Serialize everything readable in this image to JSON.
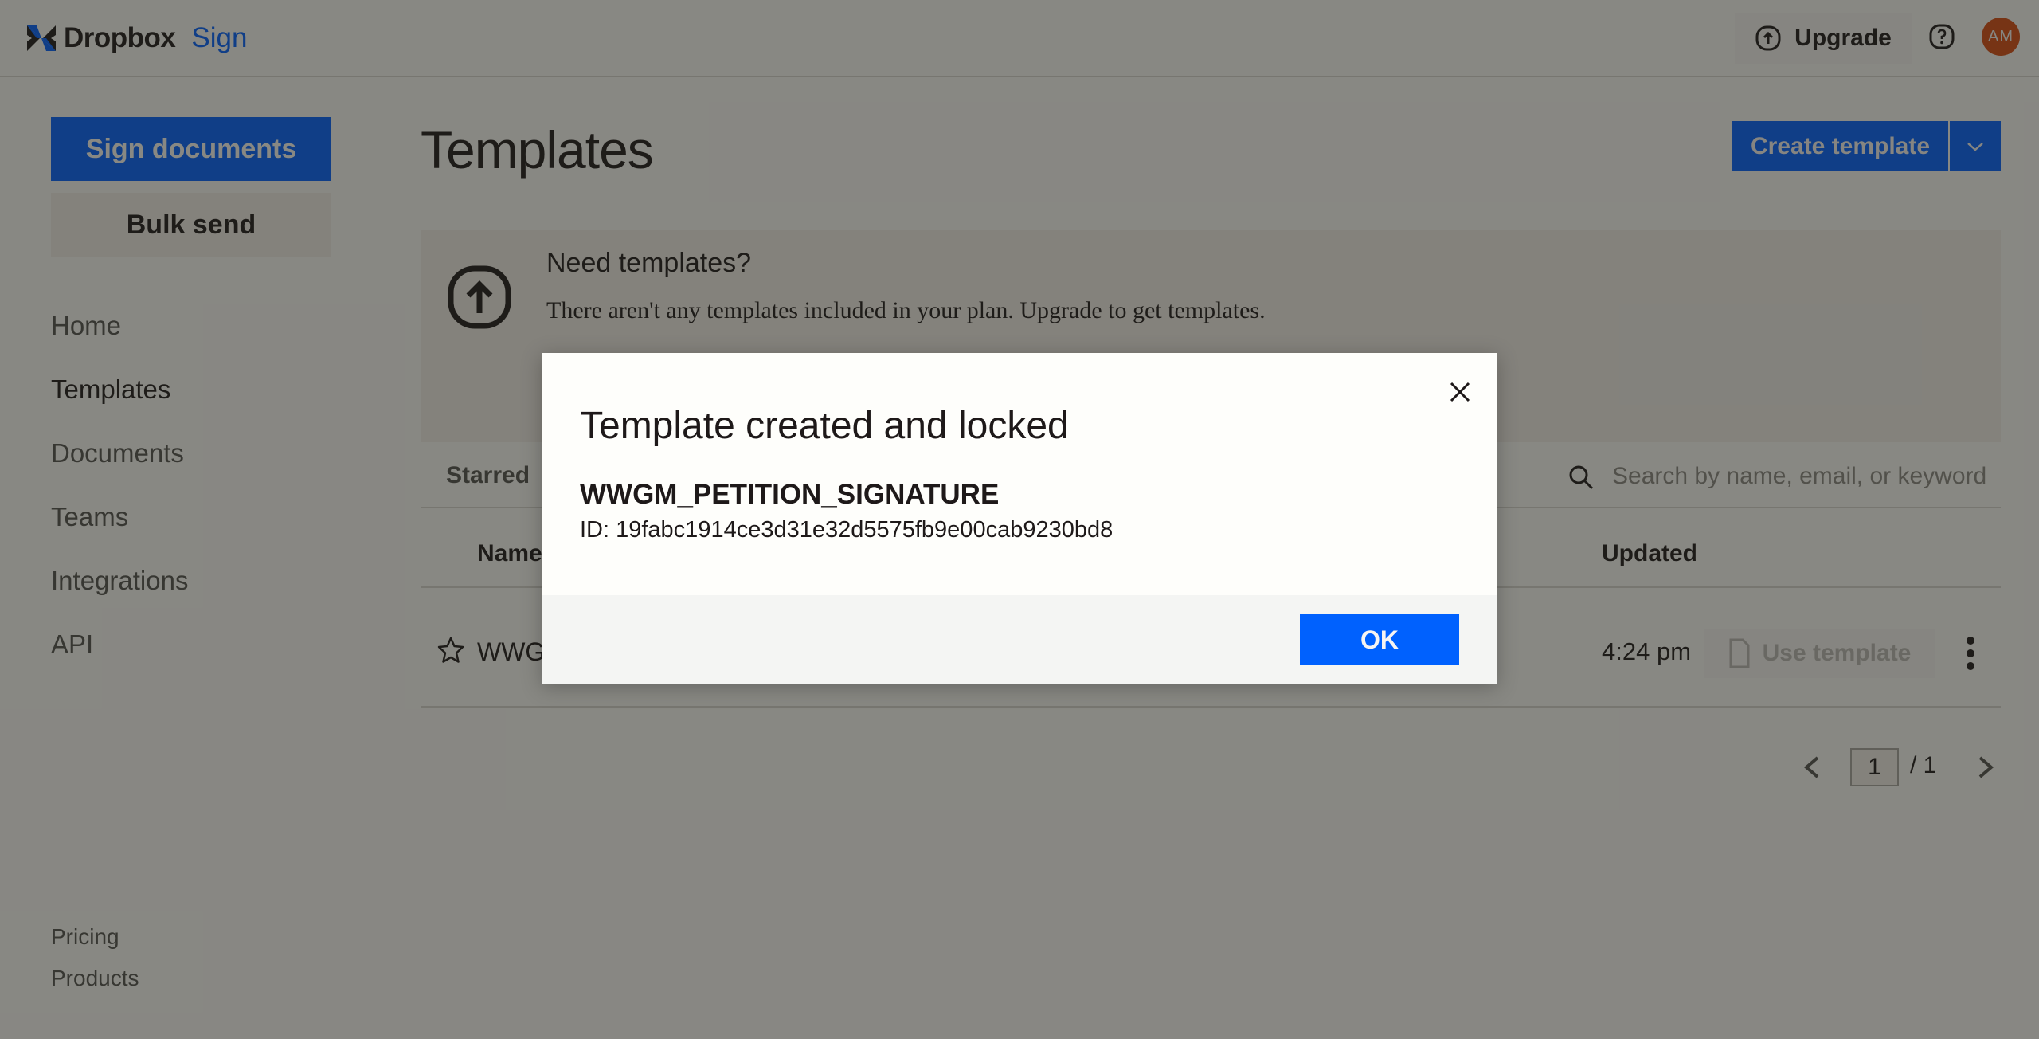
{
  "header": {
    "brand": "Dropbox",
    "product": "Sign",
    "upgrade_label": "Upgrade",
    "avatar_initials": "AM"
  },
  "sidebar": {
    "primary_button": "Sign documents",
    "secondary_button": "Bulk send",
    "nav": [
      {
        "label": "Home",
        "active": false
      },
      {
        "label": "Templates",
        "active": true
      },
      {
        "label": "Documents",
        "active": false
      },
      {
        "label": "Teams",
        "active": false
      },
      {
        "label": "Integrations",
        "active": false
      },
      {
        "label": "API",
        "active": false
      }
    ],
    "footer": [
      "Pricing",
      "Products"
    ]
  },
  "main": {
    "title": "Templates",
    "create_button": "Create template",
    "banner": {
      "title": "Need templates?",
      "text": "There aren't any templates included in your plan. Upgrade to get templates."
    },
    "tabs": [
      "Starred"
    ],
    "search": {
      "placeholder": "Search by name, email, or keyword",
      "value": ""
    },
    "columns": {
      "name": "Name",
      "updated": "Updated"
    },
    "rows": [
      {
        "name": "WWG",
        "updated": "4:24 pm",
        "action": "Use template",
        "starred": false
      }
    ],
    "pagination": {
      "current": "1",
      "of_label": "/ 1"
    }
  },
  "modal": {
    "title": "Template created and locked",
    "template_name": "WWGM_PETITION_SIGNATURE",
    "template_id": "ID: 19fabc1914ce3d31e32d5575fb9e00cab9230bd8",
    "ok_label": "OK"
  },
  "colors": {
    "accent": "#0061fe",
    "avatar": "#d74d12",
    "overlay": "#7c7c77"
  }
}
